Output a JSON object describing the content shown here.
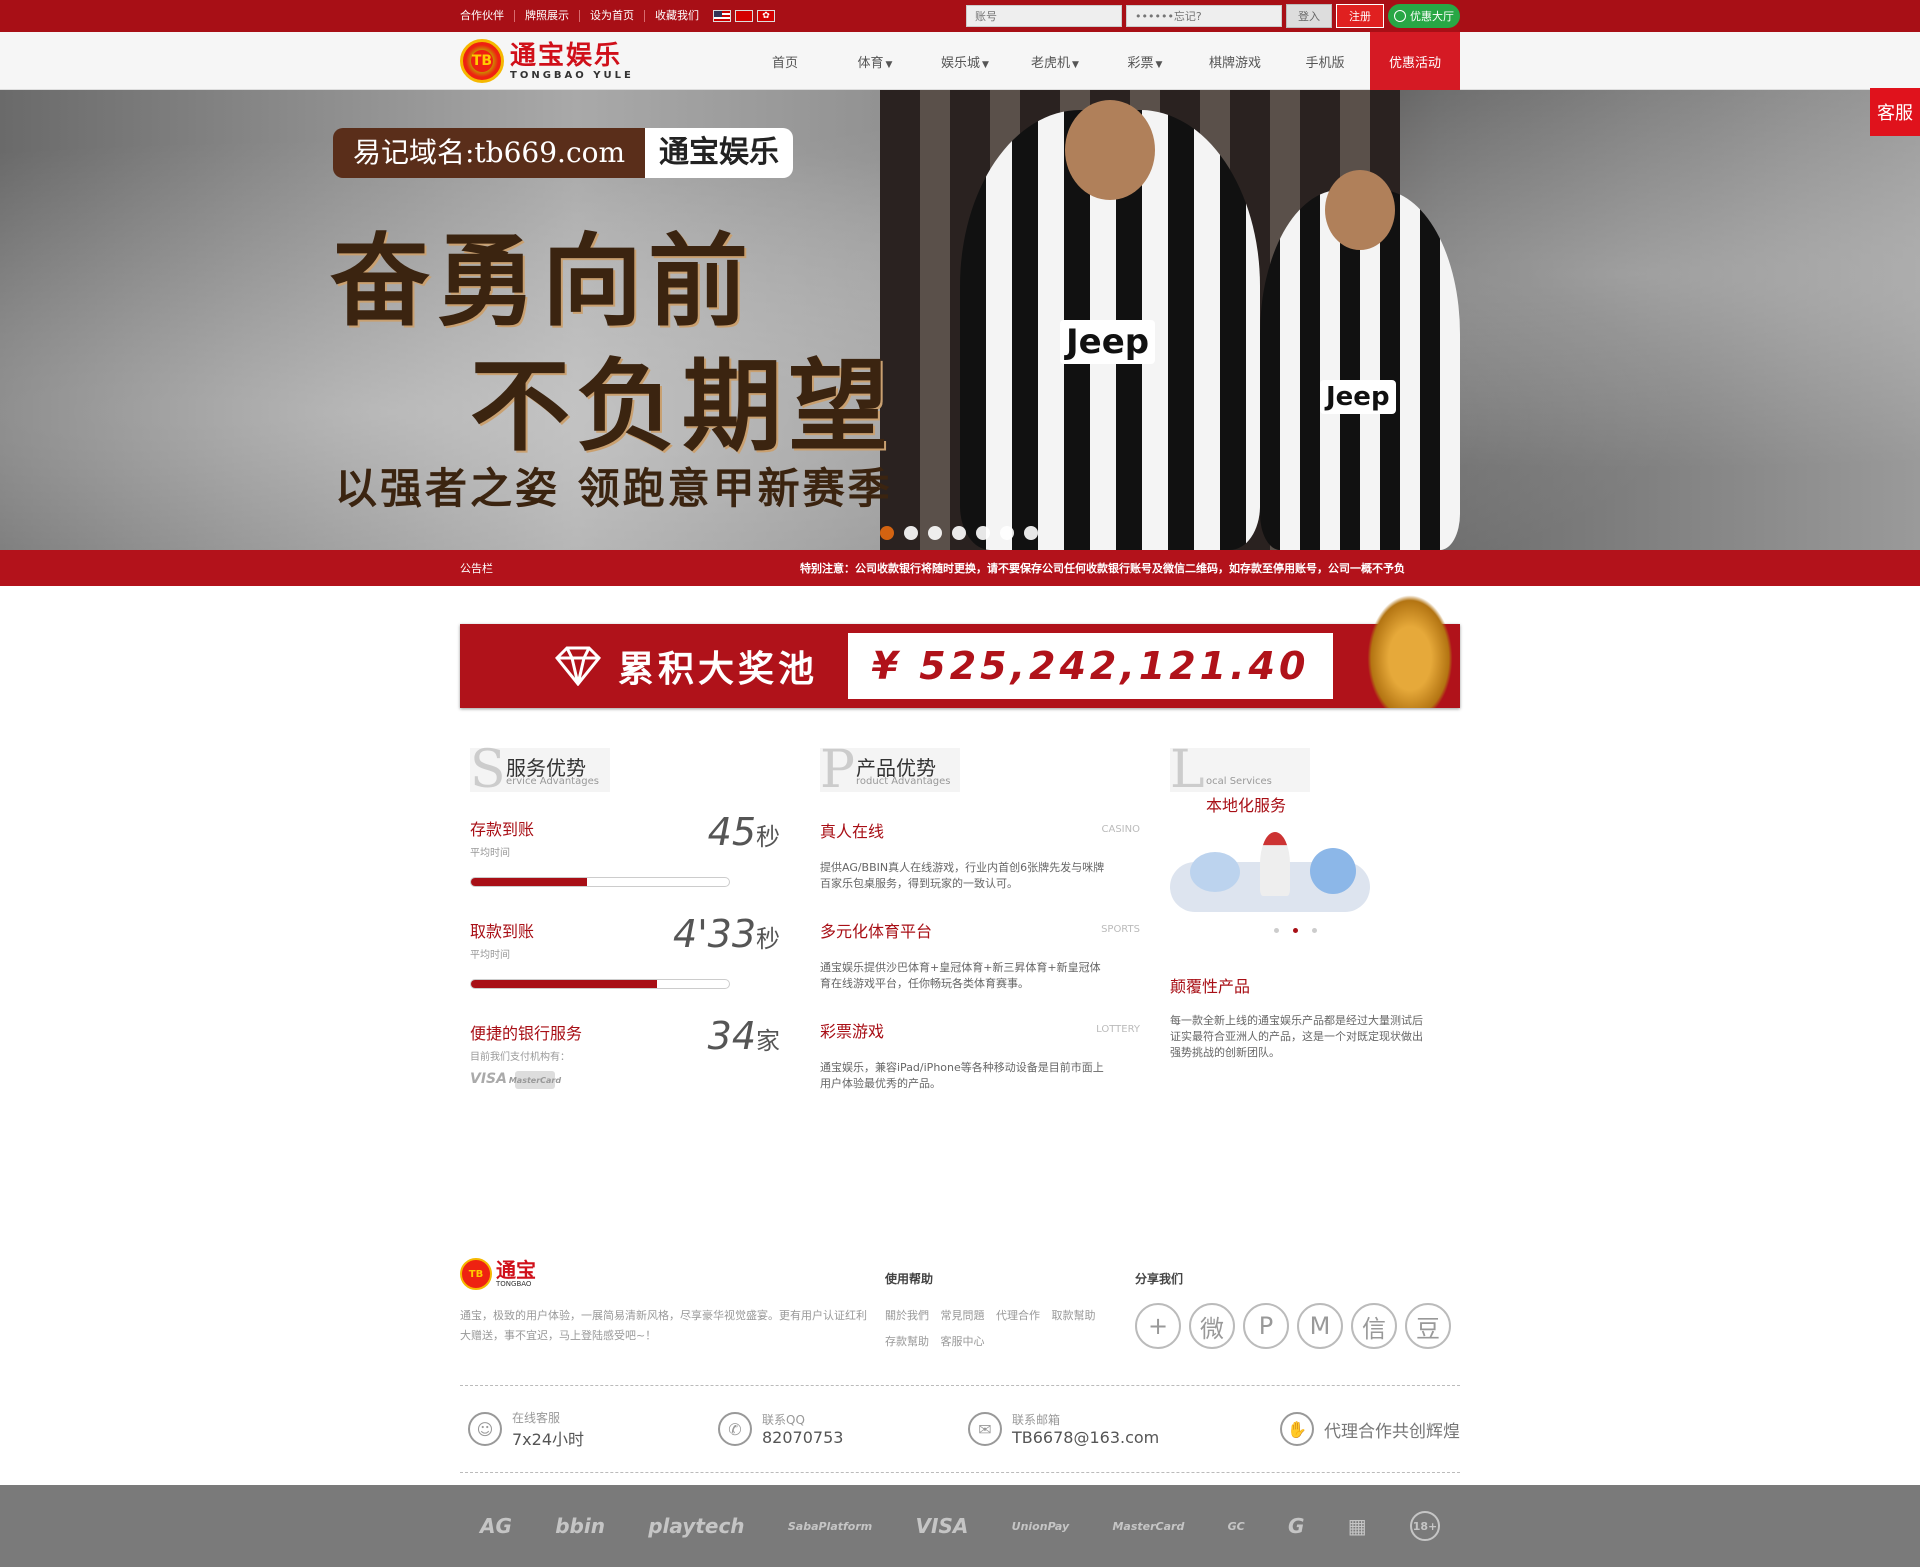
{
  "topbar": {
    "links": [
      "合作伙伴",
      "牌照展示",
      "设为首页",
      "收藏我们"
    ],
    "account_placeholder": "账号",
    "password_placeholder": "••••••忘记?",
    "login": "登入",
    "register": "注册",
    "promo_hall": "优惠大厅"
  },
  "logo": {
    "cn": "通宝娱乐",
    "en": "TONGBAO YULE",
    "coin": "TB"
  },
  "nav": {
    "items": [
      "首页",
      "体育",
      "娱乐城",
      "老虎机",
      "彩票",
      "棋牌游戏",
      "手机版"
    ],
    "promo": "优惠活动"
  },
  "kefu": "客服",
  "banner": {
    "domain": "易记域名:tb669.com",
    "brand": "通宝娱乐",
    "line1": "奋勇向前",
    "line2": "不负期望",
    "line3": "以强者之姿 领跑意甲新赛季",
    "jersey": "Jeep",
    "slide_count": 7,
    "active_slide": 0
  },
  "notice": {
    "label": "公告栏",
    "message": "特别注意：公司收款银行将随时更换，请不要保存公司任何收款银行账号及微信二维码，如存款至停用账号，公司一概不予负"
  },
  "jackpot": {
    "label": "累积大奖池",
    "amount": "¥ 525,242,121.40"
  },
  "service": {
    "letter": "S",
    "title": "服务优势",
    "subtitle": "ervice Advantages",
    "stats": [
      {
        "title": "存款到账",
        "sub": "平均时间",
        "num": "45",
        "unit": "秒",
        "progress": 0.45
      },
      {
        "title": "取款到账",
        "sub": "平均时间",
        "num": "4'33",
        "unit": "秒",
        "progress": 0.72
      },
      {
        "title": "便捷的银行服务",
        "sub": "目前我们支付机构有：",
        "num": "34",
        "unit": "家"
      }
    ],
    "cards": [
      "VISA",
      "MasterCard"
    ]
  },
  "product": {
    "letter": "P",
    "title": "产品优势",
    "subtitle": "roduct Advantages",
    "items": [
      {
        "title": "真人在线",
        "tag": "CASINO",
        "desc": "提供AG/BBIN真人在线游戏，行业内首创6张牌先发与咪牌百家乐包桌服务，得到玩家的一致认可。"
      },
      {
        "title": "多元化体育平台",
        "tag": "SPORTS",
        "desc": "通宝娱乐提供沙巴体育+皇冠体育+新三昇体育+新皇冠体育在线游戏平台，任你畅玩各类体育赛事。"
      },
      {
        "title": "彩票游戏",
        "tag": "LOTTERY",
        "desc": "通宝娱乐，兼容iPad/iPhone等各种移动设备是目前市面上用户体验最优秀的产品。"
      }
    ]
  },
  "local": {
    "letter": "L",
    "title": "本地化服务",
    "subtitle": "ocal Services",
    "item_title": "颠覆性产品",
    "desc": "每一款全新上线的通宝娱乐产品都是经过大量测试后证实最符合亚洲人的产品，这是一个对既定现状做出强势挑战的创新团队。"
  },
  "footer": {
    "logo_cn": "通宝",
    "logo_en": "TONGBAO",
    "about": "通宝，极致的用户体验，一展简易清新风格，尽享豪华视觉盛宴。更有用户认证红利大赠送，事不宜迟，马上登陆感受吧~！",
    "help_title": "使用帮助",
    "help_links": [
      "關於我們",
      "常見問題",
      "代理合作",
      "取款幫助",
      "存款幫助",
      "客服中心"
    ],
    "share_title": "分享我们",
    "share_icons": [
      "+",
      "微",
      "P",
      "M",
      "信",
      "豆"
    ],
    "contacts": [
      {
        "label": "在线客服",
        "value": "7x24小时",
        "icon": "☺"
      },
      {
        "label": "联系QQ",
        "value": "82070753",
        "icon": "✆"
      },
      {
        "label": "联系邮箱",
        "value": "TB6678@163.com",
        "icon": "✉"
      }
    ],
    "agent": "代理合作共创辉煌"
  },
  "partners": [
    "AG",
    "bbin",
    "playtech",
    "SabaPlatform",
    "VISA",
    "UnionPay",
    "MasterCard",
    "GC",
    "G",
    "▦",
    "18+"
  ]
}
